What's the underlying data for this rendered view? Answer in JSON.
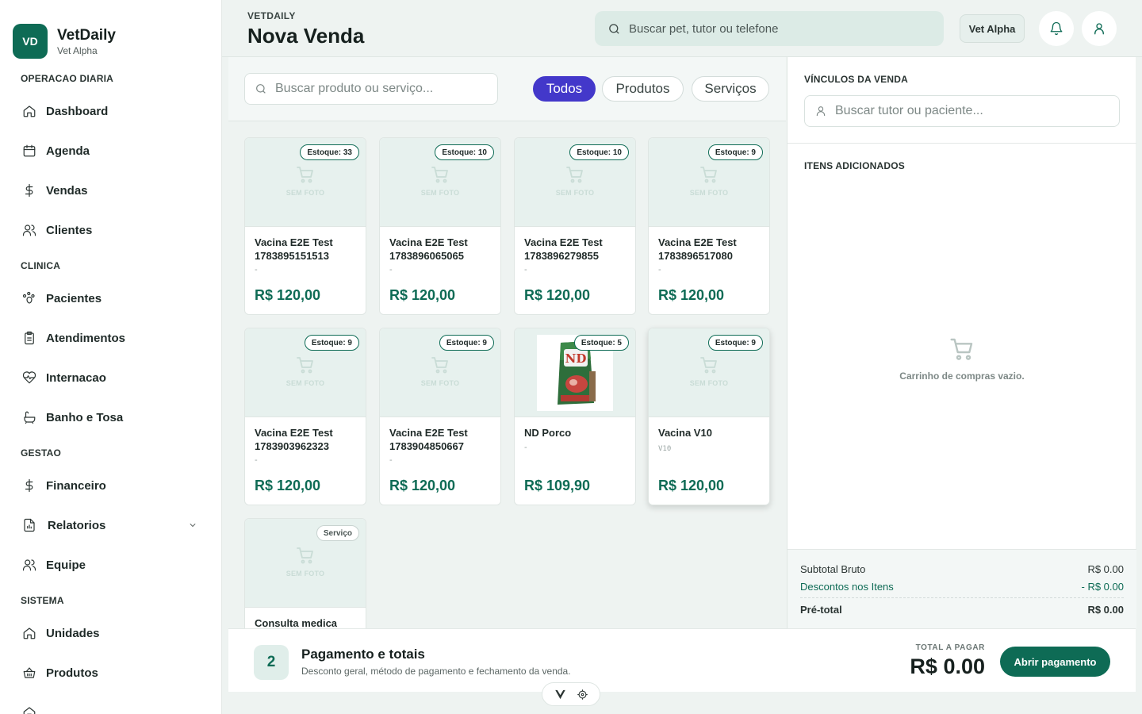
{
  "brand": {
    "initials": "VD",
    "name": "VetDaily",
    "subtitle": "Vet Alpha"
  },
  "sidebar": {
    "sections": [
      {
        "title": "OPERACAO DIARIA",
        "items": [
          {
            "label": "Dashboard",
            "icon": "home-icon"
          },
          {
            "label": "Agenda",
            "icon": "calendar-icon"
          },
          {
            "label": "Vendas",
            "icon": "dollar-icon"
          },
          {
            "label": "Clientes",
            "icon": "users-icon"
          }
        ]
      },
      {
        "title": "CLINICA",
        "items": [
          {
            "label": "Pacientes",
            "icon": "paw-icon"
          },
          {
            "label": "Atendimentos",
            "icon": "clipboard-icon"
          },
          {
            "label": "Internacao",
            "icon": "heart-pulse-icon"
          },
          {
            "label": "Banho e Tosa",
            "icon": "bath-icon"
          }
        ]
      },
      {
        "title": "GESTAO",
        "items": [
          {
            "label": "Financeiro",
            "icon": "dollar-icon"
          },
          {
            "label": "Relatorios",
            "icon": "report-icon"
          },
          {
            "label": "Equipe",
            "icon": "users-icon"
          }
        ]
      },
      {
        "title": "SISTEMA",
        "items": [
          {
            "label": "Unidades",
            "icon": "home-icon"
          },
          {
            "label": "Produtos",
            "icon": "basket-icon"
          }
        ]
      }
    ]
  },
  "header": {
    "kicker": "VETDAILY",
    "title": "Nova Venda",
    "search_placeholder": "Buscar pet, tutor ou telefone",
    "clinic_button": "Vet Alpha"
  },
  "catalog": {
    "search_placeholder": "Buscar produto ou serviço...",
    "filters": [
      {
        "label": "Todos",
        "active": true
      },
      {
        "label": "Produtos",
        "active": false
      },
      {
        "label": "Serviços",
        "active": false
      }
    ],
    "no_photo_label": "SEM FOTO",
    "items": [
      {
        "badge": "Estoque: 33",
        "name": "Vacina E2E Test 1783895151513",
        "desc": "-",
        "price": "R$ 120,00"
      },
      {
        "badge": "Estoque: 10",
        "name": "Vacina E2E Test 1783896065065",
        "desc": "-",
        "price": "R$ 120,00"
      },
      {
        "badge": "Estoque: 10",
        "name": "Vacina E2E Test 1783896279855",
        "desc": "-",
        "price": "R$ 120,00"
      },
      {
        "badge": "Estoque: 9",
        "name": "Vacina E2E Test 1783896517080",
        "desc": "-",
        "price": "R$ 120,00"
      },
      {
        "badge": "Estoque: 9",
        "name": "Vacina E2E Test 1783903962323",
        "desc": "-",
        "price": "R$ 120,00"
      },
      {
        "badge": "Estoque: 9",
        "name": "Vacina E2E Test 1783904850667",
        "desc": "-",
        "price": "R$ 120,00"
      },
      {
        "badge": "Estoque: 5",
        "name": "ND Porco",
        "desc": "-",
        "price": "R$ 109,90",
        "has_photo": true,
        "photo_logo": "ND"
      },
      {
        "badge": "Estoque: 9",
        "name": "Vacina V10",
        "desc": "V10",
        "price": "R$ 120,00"
      },
      {
        "badge": "Serviço",
        "name": "Consulta medica",
        "desc": "",
        "price": ""
      }
    ]
  },
  "sale_panel": {
    "links_title": "VÍNCULOS DA VENDA",
    "tutor_placeholder": "Buscar tutor ou paciente...",
    "items_title": "ITENS ADICIONADOS",
    "empty_text": "Carrinho de compras vazio.",
    "subtotal_label": "Subtotal Bruto",
    "subtotal_value": "R$ 0.00",
    "discount_label": "Descontos nos Itens",
    "discount_value": "- R$ 0.00",
    "pretotal_label": "Pré-total",
    "pretotal_value": "R$ 0.00"
  },
  "footer": {
    "step_number": "2",
    "step_title": "Pagamento e totais",
    "step_desc": "Desconto geral, método de pagamento e fechamento da venda.",
    "total_label": "TOTAL A PAGAR",
    "total_value": "R$ 0.00",
    "pay_button": "Abrir pagamento"
  },
  "colors": {
    "brand": "#0e6b55",
    "active_chip": "#4338ca"
  }
}
